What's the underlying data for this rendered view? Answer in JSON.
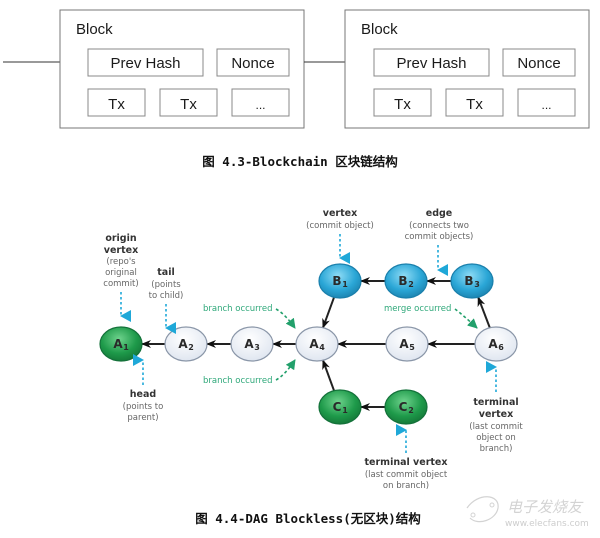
{
  "figure1": {
    "blocks": [
      {
        "title": "Block",
        "prev_hash": "Prev Hash",
        "nonce": "Nonce",
        "tx": [
          "Tx",
          "Tx",
          "..."
        ]
      },
      {
        "title": "Block",
        "prev_hash": "Prev Hash",
        "nonce": "Nonce",
        "tx": [
          "Tx",
          "Tx",
          "..."
        ]
      }
    ],
    "caption": "图 4.3-Blockchain 区块链结构"
  },
  "figure2": {
    "nodes": [
      {
        "id": "A1",
        "letter": "A",
        "sub": "1",
        "style": "green"
      },
      {
        "id": "A2",
        "letter": "A",
        "sub": "2",
        "style": "light"
      },
      {
        "id": "A3",
        "letter": "A",
        "sub": "3",
        "style": "light"
      },
      {
        "id": "A4",
        "letter": "A",
        "sub": "4",
        "style": "light"
      },
      {
        "id": "A5",
        "letter": "A",
        "sub": "5",
        "style": "light"
      },
      {
        "id": "A6",
        "letter": "A",
        "sub": "6",
        "style": "light"
      },
      {
        "id": "B1",
        "letter": "B",
        "sub": "1",
        "style": "blue"
      },
      {
        "id": "B2",
        "letter": "B",
        "sub": "2",
        "style": "blue"
      },
      {
        "id": "B3",
        "letter": "B",
        "sub": "3",
        "style": "blue"
      },
      {
        "id": "C1",
        "letter": "C",
        "sub": "1",
        "style": "green"
      },
      {
        "id": "C2",
        "letter": "C",
        "sub": "2",
        "style": "green"
      }
    ],
    "edges": [
      {
        "from": "A2",
        "to": "A1"
      },
      {
        "from": "A3",
        "to": "A2"
      },
      {
        "from": "A4",
        "to": "A3"
      },
      {
        "from": "A5",
        "to": "A4"
      },
      {
        "from": "A6",
        "to": "A5"
      },
      {
        "from": "B1",
        "to": "A4"
      },
      {
        "from": "B2",
        "to": "B1"
      },
      {
        "from": "B3",
        "to": "B2"
      },
      {
        "from": "A6",
        "to": "B3"
      },
      {
        "from": "C1",
        "to": "A4"
      },
      {
        "from": "C2",
        "to": "C1"
      }
    ],
    "annotations": {
      "origin_vertex": {
        "title": [
          "origin",
          "vertex"
        ],
        "desc": [
          "(repo's",
          "original",
          "commit)"
        ]
      },
      "tail": {
        "title": [
          "tail"
        ],
        "desc": [
          "(points",
          "to child)"
        ]
      },
      "head": {
        "title": [
          "head"
        ],
        "desc": [
          "(points to",
          "parent)"
        ]
      },
      "vertex": {
        "title": [
          "vertex"
        ],
        "desc": [
          "(commit object)"
        ]
      },
      "edge": {
        "title": [
          "edge"
        ],
        "desc": [
          "(connects two",
          "commit objects)"
        ]
      },
      "branch_top": "branch occurred",
      "branch_bottom": "branch occurred",
      "merge": "merge occurred",
      "terminal_right": {
        "title": [
          "terminal",
          "vertex"
        ],
        "desc": [
          "(last commit",
          "object on",
          "branch)"
        ]
      },
      "terminal_bottom": {
        "title": [
          "terminal vertex"
        ],
        "desc": [
          "(last commit object",
          "on branch)"
        ]
      }
    },
    "caption": "图 4.4-DAG Blockless(无区块)结构"
  },
  "watermark": {
    "brand": "电子发烧友",
    "url": "www.elecfans.com"
  },
  "colors": {
    "green_node": "#1e9a4a",
    "blue_node": "#2aa6d6",
    "light_node": "#e8edf5",
    "cyan_arrow": "#1fa8d8",
    "green_label": "#2fa87a",
    "border_gray": "#777777"
  }
}
